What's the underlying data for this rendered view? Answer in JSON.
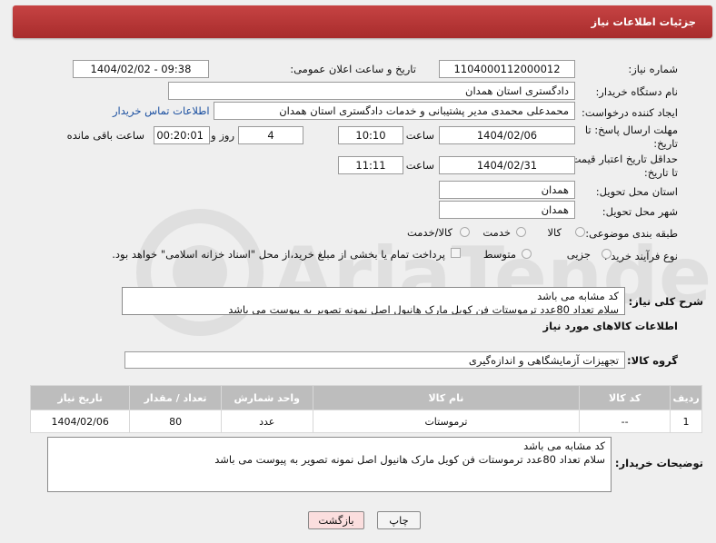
{
  "header": {
    "title": "جزئیات اطلاعات نیاز"
  },
  "fields": {
    "need_number_label": "شماره نیاز:",
    "need_number": "1104000112000012",
    "announce_label": "تاریخ و ساعت اعلان عمومی:",
    "announce_value": "1404/02/02 - 09:38",
    "buyer_org_label": "نام دستگاه خریدار:",
    "buyer_org": "دادگستری استان همدان",
    "requester_label": "ایجاد کننده درخواست:",
    "requester": "محمدعلی محمدی مدیر پشتیبانی و خدمات دادگستری استان همدان",
    "buyer_contact_link": "اطلاعات تماس خریدار",
    "reply_deadline_label_1": "مهلت ارسال پاسخ: تا",
    "reply_deadline_label_2": "تاریخ:",
    "reply_date": "1404/02/06",
    "time_label": "ساعت",
    "reply_time": "10:10",
    "days_value": "4",
    "days_label": "روز و",
    "remaining_time": "00:20:01",
    "remaining_label": "ساعت باقی مانده",
    "validity_label_1": "حداقل تاریخ اعتبار قیمت:",
    "validity_label_2": "تا تاریخ:",
    "validity_date": "1404/02/31",
    "validity_time": "11:11",
    "province_label": "استان محل تحویل:",
    "province": "همدان",
    "city_label": "شهر محل تحویل:",
    "city": "همدان",
    "category_label": "طبقه بندی موضوعی:",
    "category_options": [
      "کالا",
      "خدمت",
      "کالا/خدمت"
    ],
    "process_label": "نوع فرآیند خرید :",
    "process_options": [
      "جزیی",
      "متوسط"
    ],
    "payment_note": "پرداخت تمام یا بخشی از مبلغ خرید،از محل \"اسناد خزانه اسلامی\" خواهد بود."
  },
  "description": {
    "label": "شرح کلی نیاز:",
    "line1": "کد مشابه می باشد",
    "line2": "سلام تعداد 80عدد ترموستات  فن کویل  مارک هانیول اصل نمونه تصویر به پیوست می باشد"
  },
  "goods_section": {
    "title": "اطلاعات کالاهای مورد نیاز",
    "group_label": "گروه کالا:",
    "group_value": "تجهیزات آزمایشگاهی و اندازه‌گیری"
  },
  "table": {
    "headers": [
      "ردیف",
      "کد کالا",
      "نام کالا",
      "واحد شمارش",
      "تعداد / مقدار",
      "تاریخ نیاز"
    ],
    "rows": [
      [
        "1",
        "--",
        "ترموستات",
        "عدد",
        "80",
        "1404/02/06"
      ]
    ]
  },
  "buyer_notes": {
    "label": "توضیحات خریدار:",
    "line1": "کد مشابه می باشد",
    "line2": "سلام تعداد 80عدد ترموستات  فن کویل  مارک هانیول اصل نمونه تصویر به پیوست می باشد"
  },
  "buttons": {
    "print": "چاپ",
    "back": "بازگشت"
  },
  "watermark": {
    "text": "AriaTender.net"
  },
  "colors": {
    "header": "#b83636",
    "back_button_bg": "#fbdede",
    "link": "#1a4fa0"
  }
}
